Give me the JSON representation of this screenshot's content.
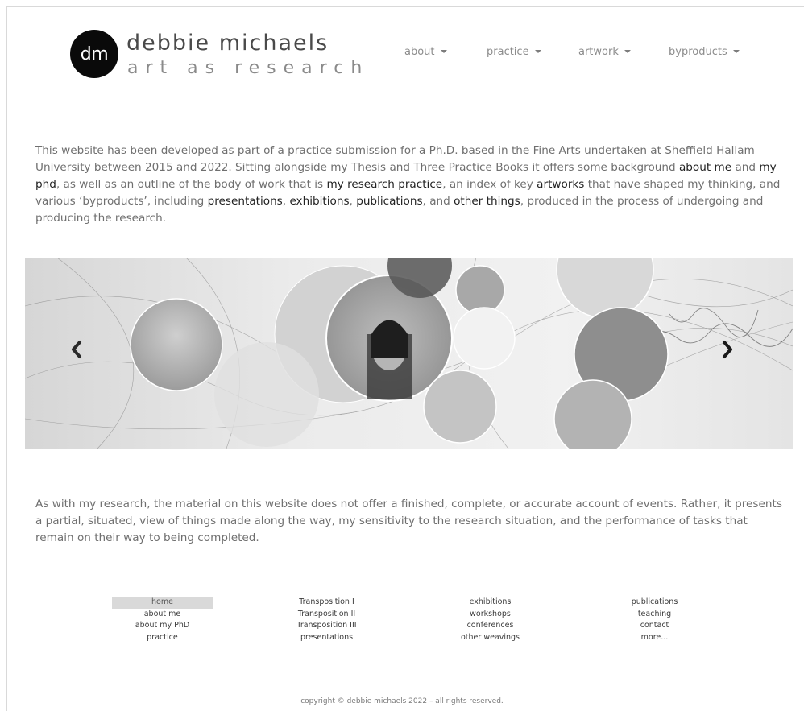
{
  "header": {
    "logo_initials": "dm",
    "logo_name": "debbie michaels",
    "logo_tagline": "art as research"
  },
  "nav": [
    {
      "label": "about"
    },
    {
      "label": "practice"
    },
    {
      "label": "artwork"
    },
    {
      "label": "byproducts"
    }
  ],
  "intro": {
    "t1": "This website has been developed as part of a practice submission for a Ph.D. based in the Fine Arts undertaken at Sheffield Hallam University between 2015 and 2022. Sitting alongside my Thesis and Three Practice Books it offers some background ",
    "l1": "about me",
    "t2": " and ",
    "l2": "my phd",
    "t3": ", as well as an outline of the body of work that is ",
    "l3": "my research practice",
    "t4": ", an index of key ",
    "l4": "artworks",
    "t5": " that have shaped my thinking, and various ‘byproducts’, including ",
    "l5": "presentations",
    "t6": ", ",
    "l6": "exhibitions",
    "t7": ", ",
    "l7": "publications",
    "t8": ", and ",
    "l8": "other things",
    "t9": ", produced in the process of undergoing and producing the research."
  },
  "carousel": {
    "prev_icon": "chevron-left-icon",
    "next_icon": "chevron-right-icon"
  },
  "outro": {
    "text": "As with my research, the material on this website does not offer a finished, complete, or accurate account of events. Rather, it presents a partial, situated, view of things made along the way, my sensitivity to the research situation, and the performance of tasks that remain on their way to being completed."
  },
  "footer": {
    "col1": [
      "home",
      "about me",
      "about my PhD",
      "practice"
    ],
    "col2": [
      "Transposition I",
      "Transposition II",
      "Transposition III",
      "presentations"
    ],
    "col3": [
      "exhibitions",
      "workshops",
      "conferences",
      "other weavings"
    ],
    "col4": [
      "publications",
      "teaching",
      "contact",
      "more..."
    ],
    "copyright": "copyright © debbie michaels 2022 – all rights reserved."
  },
  "colors": {
    "link": "#222222",
    "text": "#6f6f6f",
    "active_bg": "#d9d9d9"
  }
}
